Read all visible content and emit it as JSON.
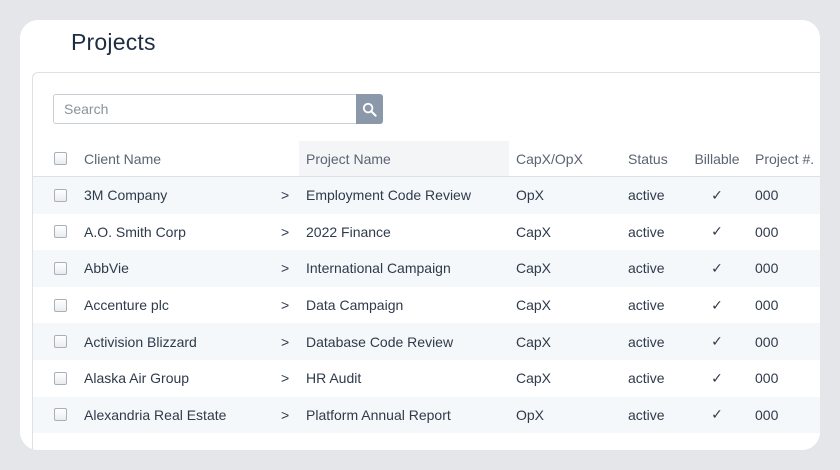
{
  "page": {
    "title": "Projects"
  },
  "search": {
    "placeholder": "Search"
  },
  "icons": {
    "search": "search-icon",
    "chevron": "chevron-right-icon",
    "check": "checkmark-icon"
  },
  "colors": {
    "search_button": "#8a98aa",
    "alt_row": "#f5f8fa",
    "title": "#1f2d44"
  },
  "table": {
    "headers": {
      "client": "Client Name",
      "project": "Project Name",
      "capx": "CapX/OpX",
      "status": "Status",
      "billable": "Billable",
      "project_num": "Project #."
    },
    "rows": [
      {
        "client": "3M Company",
        "chevron": ">",
        "project": "Employment Code Review",
        "capx": "OpX",
        "status": "active",
        "billable": "✓",
        "project_num": "000"
      },
      {
        "client": "A.O. Smith Corp",
        "chevron": ">",
        "project": "2022 Finance",
        "capx": "CapX",
        "status": "active",
        "billable": "✓",
        "project_num": "000"
      },
      {
        "client": "AbbVie",
        "chevron": ">",
        "project": "International Campaign",
        "capx": "CapX",
        "status": "active",
        "billable": "✓",
        "project_num": "000"
      },
      {
        "client": "Accenture plc",
        "chevron": ">",
        "project": "Data Campaign",
        "capx": "CapX",
        "status": "active",
        "billable": "✓",
        "project_num": "000"
      },
      {
        "client": "Activision Blizzard",
        "chevron": ">",
        "project": "Database Code Review",
        "capx": "CapX",
        "status": "active",
        "billable": "✓",
        "project_num": "000"
      },
      {
        "client": "Alaska Air Group",
        "chevron": ">",
        "project": "HR Audit",
        "capx": "CapX",
        "status": "active",
        "billable": "✓",
        "project_num": "000"
      },
      {
        "client": "Alexandria Real Estate",
        "chevron": ">",
        "project": "Platform Annual Report",
        "capx": "OpX",
        "status": "active",
        "billable": "✓",
        "project_num": "000"
      }
    ]
  }
}
